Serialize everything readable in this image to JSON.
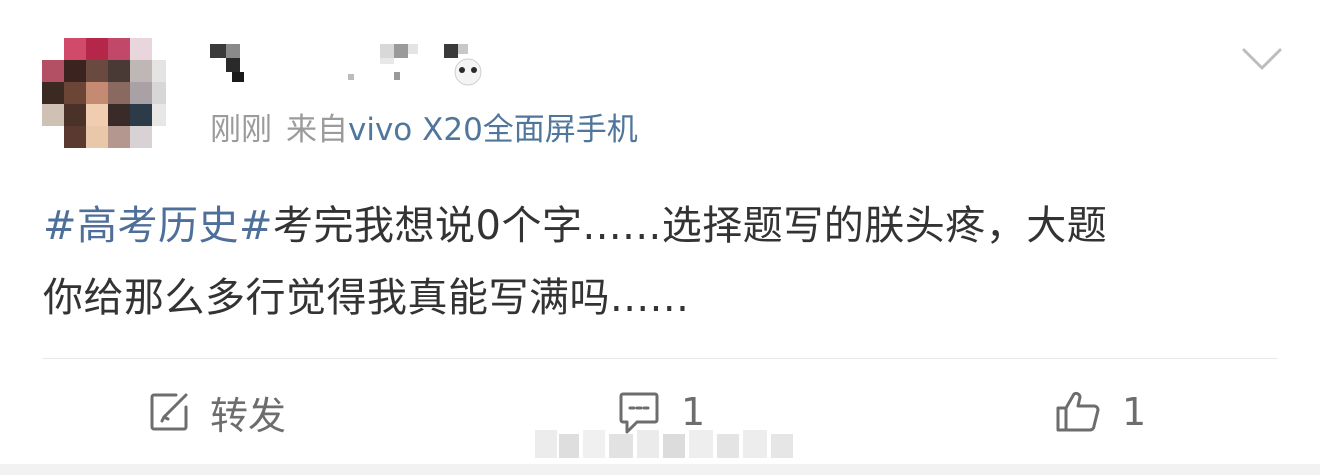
{
  "post": {
    "time": "刚刚",
    "source_prefix": "来自",
    "device": "vivo X20全面屏手机",
    "hashtag": "#高考历史#",
    "content_line1": "考完我想说0个字......选择题写的朕头疼，大题",
    "content_line2": "你给那么多行觉得我真能写满吗......"
  },
  "icons": {
    "menu": "chevron-down-icon",
    "repost": "repost-icon",
    "comment": "comment-icon",
    "like": "thumbs-up-icon"
  },
  "actions": {
    "repost_label": "转发",
    "comment_count": "1",
    "like_count": "1"
  },
  "colors": {
    "link": "#4e6f99",
    "device": "#51769c",
    "meta_gray": "#9b9b9b",
    "text": "#333333",
    "action_gray": "#6d6d6d"
  }
}
